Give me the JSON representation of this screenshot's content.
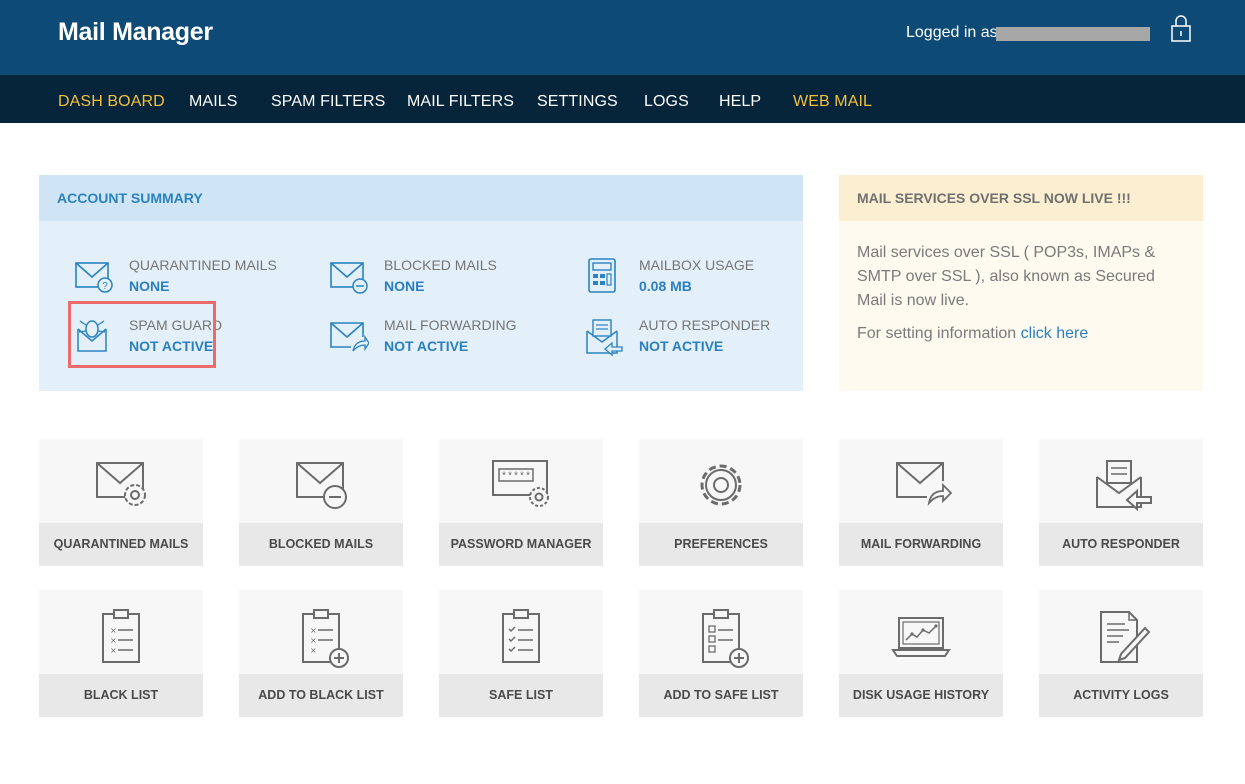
{
  "app": {
    "title": "Mail Manager"
  },
  "header": {
    "logged_in_label": "Logged in as",
    "lock_icon": "lock-icon"
  },
  "nav": {
    "items": [
      {
        "label": "DASH BOARD",
        "active": true
      },
      {
        "label": "MAILS"
      },
      {
        "label": "SPAM FILTERS"
      },
      {
        "label": "MAIL FILTERS"
      },
      {
        "label": "SETTINGS"
      },
      {
        "label": "LOGS"
      },
      {
        "label": "HELP"
      },
      {
        "label": "WEB MAIL",
        "highlight": true
      }
    ],
    "active_color": "#f2c13b"
  },
  "summary": {
    "title": "ACCOUNT SUMMARY",
    "stats": [
      {
        "label": "QUARANTINED MAILS",
        "value": "NONE",
        "icon": "mail-question-icon"
      },
      {
        "label": "BLOCKED MAILS",
        "value": "NONE",
        "icon": "mail-blocked-icon"
      },
      {
        "label": "MAILBOX USAGE",
        "value": "0.08 MB",
        "icon": "calculator-icon"
      },
      {
        "label": "SPAM GUARD",
        "value": "NOT ACTIVE",
        "icon": "bug-shield-icon"
      },
      {
        "label": "MAIL FORWARDING",
        "value": "NOT ACTIVE",
        "icon": "mail-forward-icon"
      },
      {
        "label": "AUTO RESPONDER",
        "value": "NOT ACTIVE",
        "icon": "auto-reply-icon"
      }
    ]
  },
  "notice": {
    "title": "MAIL SERVICES OVER SSL NOW LIVE !!!",
    "body": "Mail services over SSL ( POP3s, IMAPs & SMTP over SSL ), also known as Secured Mail is now live.",
    "setting_text": "For setting information",
    "link_text": "click here"
  },
  "tiles": [
    {
      "label": "QUARANTINED MAILS",
      "icon": "mail-gear-icon"
    },
    {
      "label": "BLOCKED MAILS",
      "icon": "mail-minus-icon"
    },
    {
      "label": "PASSWORD MANAGER",
      "icon": "password-gear-icon"
    },
    {
      "label": "PREFERENCES",
      "icon": "gear-icon"
    },
    {
      "label": "MAIL FORWARDING",
      "icon": "mail-forward-icon"
    },
    {
      "label": "AUTO RESPONDER",
      "icon": "auto-reply-icon"
    },
    {
      "label": "BLACK LIST",
      "icon": "clipboard-x-icon"
    },
    {
      "label": "ADD TO BLACK LIST",
      "icon": "clipboard-x-add-icon"
    },
    {
      "label": "SAFE LIST",
      "icon": "clipboard-check-icon"
    },
    {
      "label": "ADD TO SAFE LIST",
      "icon": "clipboard-check-add-icon"
    },
    {
      "label": "DISK USAGE HISTORY",
      "icon": "laptop-chart-icon"
    },
    {
      "label": "ACTIVITY LOGS",
      "icon": "document-pen-icon"
    }
  ]
}
